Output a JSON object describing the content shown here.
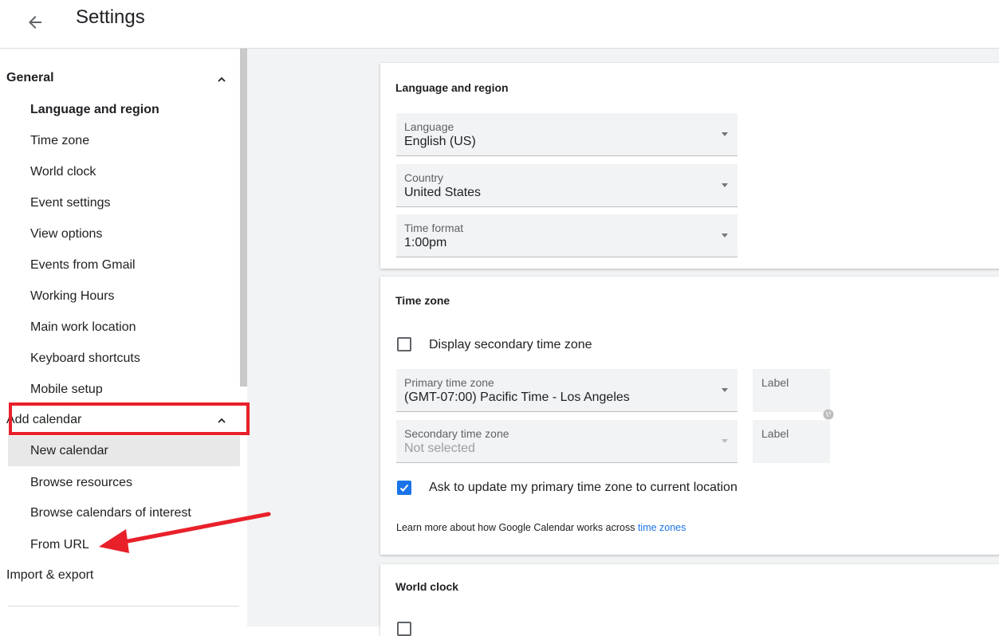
{
  "header": {
    "title": "Settings"
  },
  "sidebar": {
    "general": {
      "label": "General",
      "items": [
        "Language and region",
        "Time zone",
        "World clock",
        "Event settings",
        "View options",
        "Events from Gmail",
        "Working Hours",
        "Main work location",
        "Keyboard shortcuts",
        "Mobile setup"
      ]
    },
    "add_calendar": {
      "label": "Add calendar",
      "items": [
        "New calendar",
        "Browse resources",
        "Browse calendars of interest",
        "From URL"
      ]
    },
    "import_export": "Import & export"
  },
  "language_region": {
    "title": "Language and region",
    "language": {
      "label": "Language",
      "value": "English (US)"
    },
    "country": {
      "label": "Country",
      "value": "United States"
    },
    "time_format": {
      "label": "Time format",
      "value": "1:00pm"
    }
  },
  "time_zone": {
    "title": "Time zone",
    "secondary_checkbox": {
      "label": "Display secondary time zone",
      "checked": false
    },
    "primary": {
      "label": "Primary time zone",
      "value": "(GMT-07:00) Pacific Time - Los Angeles"
    },
    "secondary": {
      "label": "Secondary time zone",
      "value": "Not selected"
    },
    "primary_label_field": "Label",
    "secondary_label_field": "Label",
    "update_checkbox": {
      "label": "Ask to update my primary time zone to current location",
      "checked": true
    },
    "learn_more_prefix": "Learn more about how Google Calendar works across ",
    "learn_more_link": "time zones"
  },
  "world_clock": {
    "title": "World clock"
  },
  "colors": {
    "accent": "#1a73e8",
    "annotation": "#e8202a"
  }
}
